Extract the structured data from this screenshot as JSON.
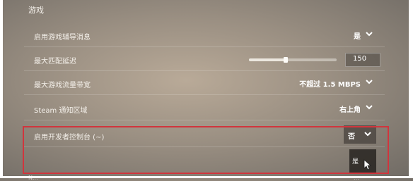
{
  "section": {
    "title": "游戏"
  },
  "settings": [
    {
      "label": "启用游戏辅导消息",
      "value": "是"
    },
    {
      "label": "最大匹配延迟",
      "slider_value": "150",
      "slider_fraction": 0.42
    },
    {
      "label": "最大游戏流量带宽",
      "value": "不超过 1.5 MBPS"
    },
    {
      "label": "Steam 通知区域",
      "value": "右上角"
    },
    {
      "label": "启用开发者控制台 (~)",
      "value": "否"
    }
  ],
  "dropdown": {
    "options": [
      "是"
    ]
  },
  "next_row": {
    "label": "N...",
    "value": "..."
  },
  "colors": {
    "highlight": "#d1353d",
    "text": "#ffffff"
  },
  "icons": {
    "chevron": "chevron-down-icon",
    "cursor": "mouse-cursor-icon"
  }
}
